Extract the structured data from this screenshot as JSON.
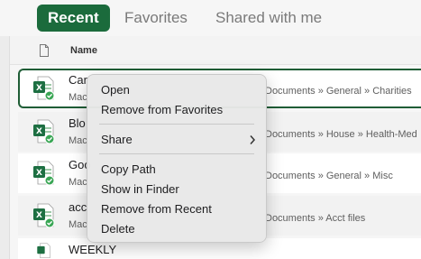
{
  "tabs": {
    "recent": "Recent",
    "favorites": "Favorites",
    "shared": "Shared with me"
  },
  "header": {
    "name_label": "Name"
  },
  "files": [
    {
      "name": "Car",
      "path_left": "Mac",
      "path_right": "Documents » General » Charities"
    },
    {
      "name": "Blo",
      "path_left": "Mac",
      "path_right": "Documents » House » Health-Med"
    },
    {
      "name": "Goo",
      "path_left": "Mac",
      "path_right": "Documents » General » Misc"
    },
    {
      "name": "acc",
      "path_left": "Mac",
      "path_right": "Documents » Acct files"
    }
  ],
  "last_file_name": "WEEKLY",
  "context_menu": {
    "open": "Open",
    "remove_favorites": "Remove from Favorites",
    "share": "Share",
    "copy_path": "Copy Path",
    "show_in_finder": "Show in Finder",
    "remove_recent": "Remove from Recent",
    "delete": "Delete"
  },
  "colors": {
    "brand_green": "#1b6b3c",
    "excel_green": "#1d6f42",
    "status_green": "#3aa655"
  },
  "icons": [
    "file-icon",
    "excel-file-icon",
    "synced-check-icon",
    "chevron-right-icon"
  ]
}
